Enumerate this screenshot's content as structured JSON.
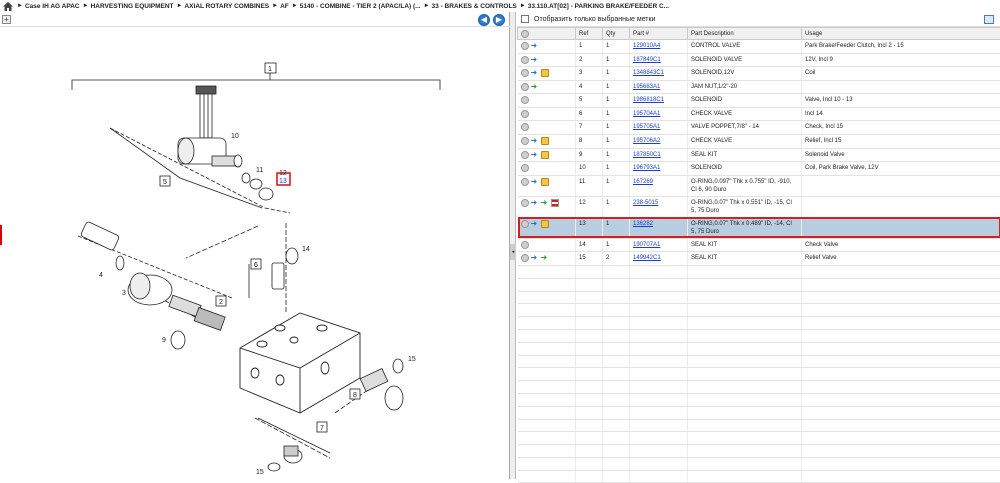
{
  "breadcrumb": [
    "Case IH AG APAC",
    "HARVESTING EQUIPMENT",
    "AXIAL ROTARY COMBINES",
    "AF",
    "5140 - COMBINE - TIER 2 (APAC/LA) (...",
    "33 - BRAKES & CONTROLS",
    "33.110.AT[02] - PARKING BRAKE/FEEDER C..."
  ],
  "filter_label": "Отобразить только выбранные метки",
  "columns": [
    "Ref",
    "Qty",
    "Part #",
    "Part Description",
    "Usage"
  ],
  "rows": [
    {
      "ref": "1",
      "qty": "1",
      "part": "129010A4",
      "desc": "CONTROL VALVE",
      "usage": "Park Brake/Feeder Clutch, Incl 2 - 15",
      "icons": [
        "arrow"
      ]
    },
    {
      "ref": "2",
      "qty": "1",
      "part": "187849C1",
      "desc": "SOLENOID VALVE",
      "usage": "12V, Incl 9",
      "icons": [
        "arrow"
      ]
    },
    {
      "ref": "3",
      "qty": "1",
      "part": "1348843C1",
      "desc": "SOLENOID,12V",
      "usage": "Coil",
      "icons": [
        "arrow",
        "box"
      ]
    },
    {
      "ref": "4",
      "qty": "1",
      "part": "195683A1",
      "desc": "JAM NUT,1/2\"-20",
      "usage": "",
      "icons": [
        "green"
      ]
    },
    {
      "ref": "5",
      "qty": "1",
      "part": "1986818C1",
      "desc": "SOLENOID",
      "usage": "Valve, Incl 10 - 13",
      "icons": []
    },
    {
      "ref": "6",
      "qty": "1",
      "part": "195704A1",
      "desc": "CHECK VALVE",
      "usage": "Incl 14",
      "icons": []
    },
    {
      "ref": "7",
      "qty": "1",
      "part": "195705A1",
      "desc": "VALVE POPPET,7/8\" - 14",
      "usage": "Check, Incl 15",
      "icons": []
    },
    {
      "ref": "8",
      "qty": "1",
      "part": "195706A2",
      "desc": "CHECK VALVE",
      "usage": "Relief, Incl 15",
      "icons": [
        "arrow",
        "box"
      ]
    },
    {
      "ref": "9",
      "qty": "1",
      "part": "187850C1",
      "desc": "SEAL KIT",
      "usage": "Solenoid Valve",
      "icons": [
        "arrow",
        "box"
      ]
    },
    {
      "ref": "10",
      "qty": "1",
      "part": "196793A1",
      "desc": "SOLENOID",
      "usage": "Coil, Park Brake Valve, 12V",
      "icons": []
    },
    {
      "ref": "11",
      "qty": "1",
      "part": "167269",
      "desc": "O-RING,0.097\" Thk x 0.755\" ID, -910, Cl 6, 90 Duro",
      "usage": "",
      "icons": [
        "arrow",
        "box"
      ],
      "tall": true
    },
    {
      "ref": "12",
      "qty": "1",
      "part": "238-5015",
      "desc": "O-RING,0.07\" Thk x 0.551\" ID, -15, Cl 5, 75 Duro",
      "usage": "",
      "icons": [
        "arrow",
        "green",
        "flag"
      ],
      "tall": true
    },
    {
      "ref": "13",
      "qty": "1",
      "part": "136282",
      "desc": "O-RING,0.07\" Thk x 0.489\" ID, -14, Cl 5, 75 Duro",
      "usage": "",
      "icons": [
        "arrow",
        "box"
      ],
      "tall": true,
      "selected": true
    },
    {
      "ref": "14",
      "qty": "1",
      "part": "190707A1",
      "desc": "SEAL KIT",
      "usage": "Check Valve",
      "icons": []
    },
    {
      "ref": "15",
      "qty": "2",
      "part": "149942C1",
      "desc": "SEAL KIT",
      "usage": "Relief Valve",
      "icons": [
        "arrow",
        "green"
      ]
    }
  ],
  "callouts": {
    "c1": "1",
    "c2": "2",
    "c3": "3",
    "c4": "4",
    "c5": "5",
    "c6": "6",
    "c7": "7",
    "c8": "8",
    "c9": "9",
    "c10": "10",
    "c11": "11",
    "c12": "12",
    "c13": "13",
    "c14": "14",
    "c15a": "15",
    "c15b": "15"
  },
  "highlight_color": "#d21f1f",
  "selected_row_color": "#b9cde0"
}
